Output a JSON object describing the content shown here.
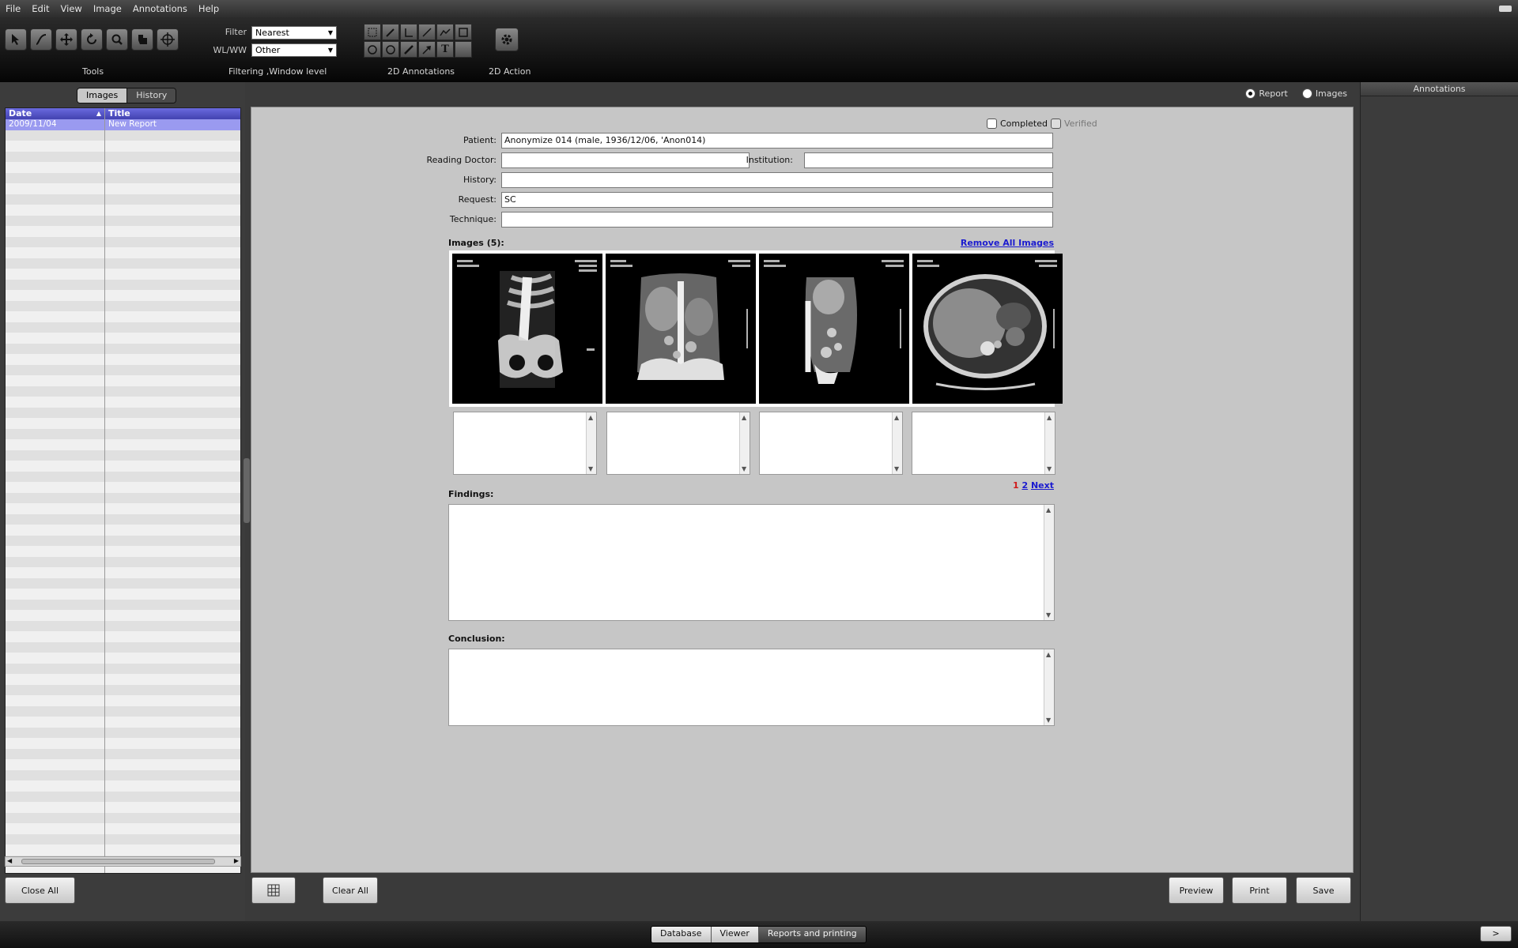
{
  "menu": [
    "File",
    "Edit",
    "View",
    "Image",
    "Annotations",
    "Help"
  ],
  "toolbar": {
    "groups": {
      "tools": "Tools",
      "filtering": "Filtering ,Window level",
      "annotations": "2D Annotations",
      "action": "2D Action"
    },
    "filter_label": "Filter",
    "filter_value": "Nearest",
    "wlww_label": "WL/WW",
    "wlww_value": "Other",
    "tool_icons": [
      "pointer-icon",
      "curve-icon",
      "move-icon",
      "rotate-icon",
      "zoom-icon",
      "pan-icon",
      "crosshair-icon"
    ],
    "annotation_icons": [
      "rect-select-icon",
      "pencil-icon",
      "angle-icon",
      "line-icon",
      "polyline-icon",
      "rectangle-icon",
      "oval-icon",
      "circle-icon",
      "brush-icon",
      "arrow-icon",
      "text-icon",
      "blank-icon"
    ]
  },
  "left": {
    "tabs": {
      "images": "Images",
      "history": "History"
    },
    "columns": {
      "date": "Date",
      "title": "Title"
    },
    "rows": [
      {
        "date": "2009/11/04",
        "title": "New Report"
      }
    ],
    "close_all": "Close All"
  },
  "view_mode": {
    "report": "Report",
    "images": "Images",
    "selected": "Report"
  },
  "report": {
    "completed": "Completed",
    "verified": "Verified",
    "patient_label": "Patient:",
    "patient_value": "Anonymize 014 (male, 1936/12/06, 'Anon014)",
    "reading_doctor_label": "Reading Doctor:",
    "reading_doctor_value": "",
    "institution_label": "Institution:",
    "institution_value": "",
    "history_label": "History:",
    "history_value": "",
    "request_label": "Request:",
    "request_value": "SC",
    "technique_label": "Technique:",
    "technique_value": "",
    "images_heading": "Images (5):",
    "remove_all": "Remove All Images",
    "pager": {
      "current": "1",
      "page2": "2",
      "next": "Next"
    },
    "findings_heading": "Findings:",
    "conclusion_heading": "Conclusion:"
  },
  "center_buttons": {
    "clear_all": "Clear All",
    "preview": "Preview",
    "print": "Print",
    "save": "Save"
  },
  "right": {
    "title": "Annotations"
  },
  "bottom": {
    "tabs": [
      "Database",
      "Viewer",
      "Reports and printing"
    ],
    "active": "Reports and printing",
    "next": ">"
  }
}
